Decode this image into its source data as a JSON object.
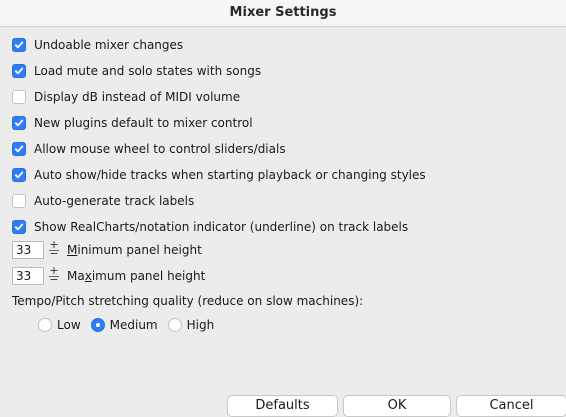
{
  "window": {
    "title": "Mixer Settings"
  },
  "options": [
    {
      "label": "Undoable mixer changes",
      "checked": true
    },
    {
      "label": "Load mute and solo states with songs",
      "checked": true
    },
    {
      "label": "Display dB instead of MIDI volume",
      "checked": false
    },
    {
      "label": "New plugins default to mixer control",
      "checked": true
    },
    {
      "label": "Allow mouse wheel to control sliders/dials",
      "checked": true
    },
    {
      "label": "Auto show/hide tracks when starting playback or changing styles",
      "checked": true
    },
    {
      "label": "Auto-generate track labels",
      "checked": false
    },
    {
      "label": "Show RealCharts/notation indicator (underline) on track labels",
      "checked": true
    }
  ],
  "min_height": {
    "value": "33",
    "label_pre": "",
    "label_key": "M",
    "label_post": "inimum panel height"
  },
  "max_height": {
    "value": "33",
    "label_pre": "Ma",
    "label_key": "x",
    "label_post": "imum panel height"
  },
  "quality": {
    "label": "Tempo/Pitch stretching quality (reduce on slow machines):",
    "options": [
      {
        "label": "Low",
        "selected": false
      },
      {
        "label": "Medium",
        "selected": true
      },
      {
        "label": "High",
        "selected": false
      }
    ]
  },
  "buttons": {
    "defaults": "Defaults",
    "ok": "OK",
    "cancel": "Cancel"
  },
  "colors": {
    "accent": "#2f7df6",
    "background": "#ececec"
  }
}
